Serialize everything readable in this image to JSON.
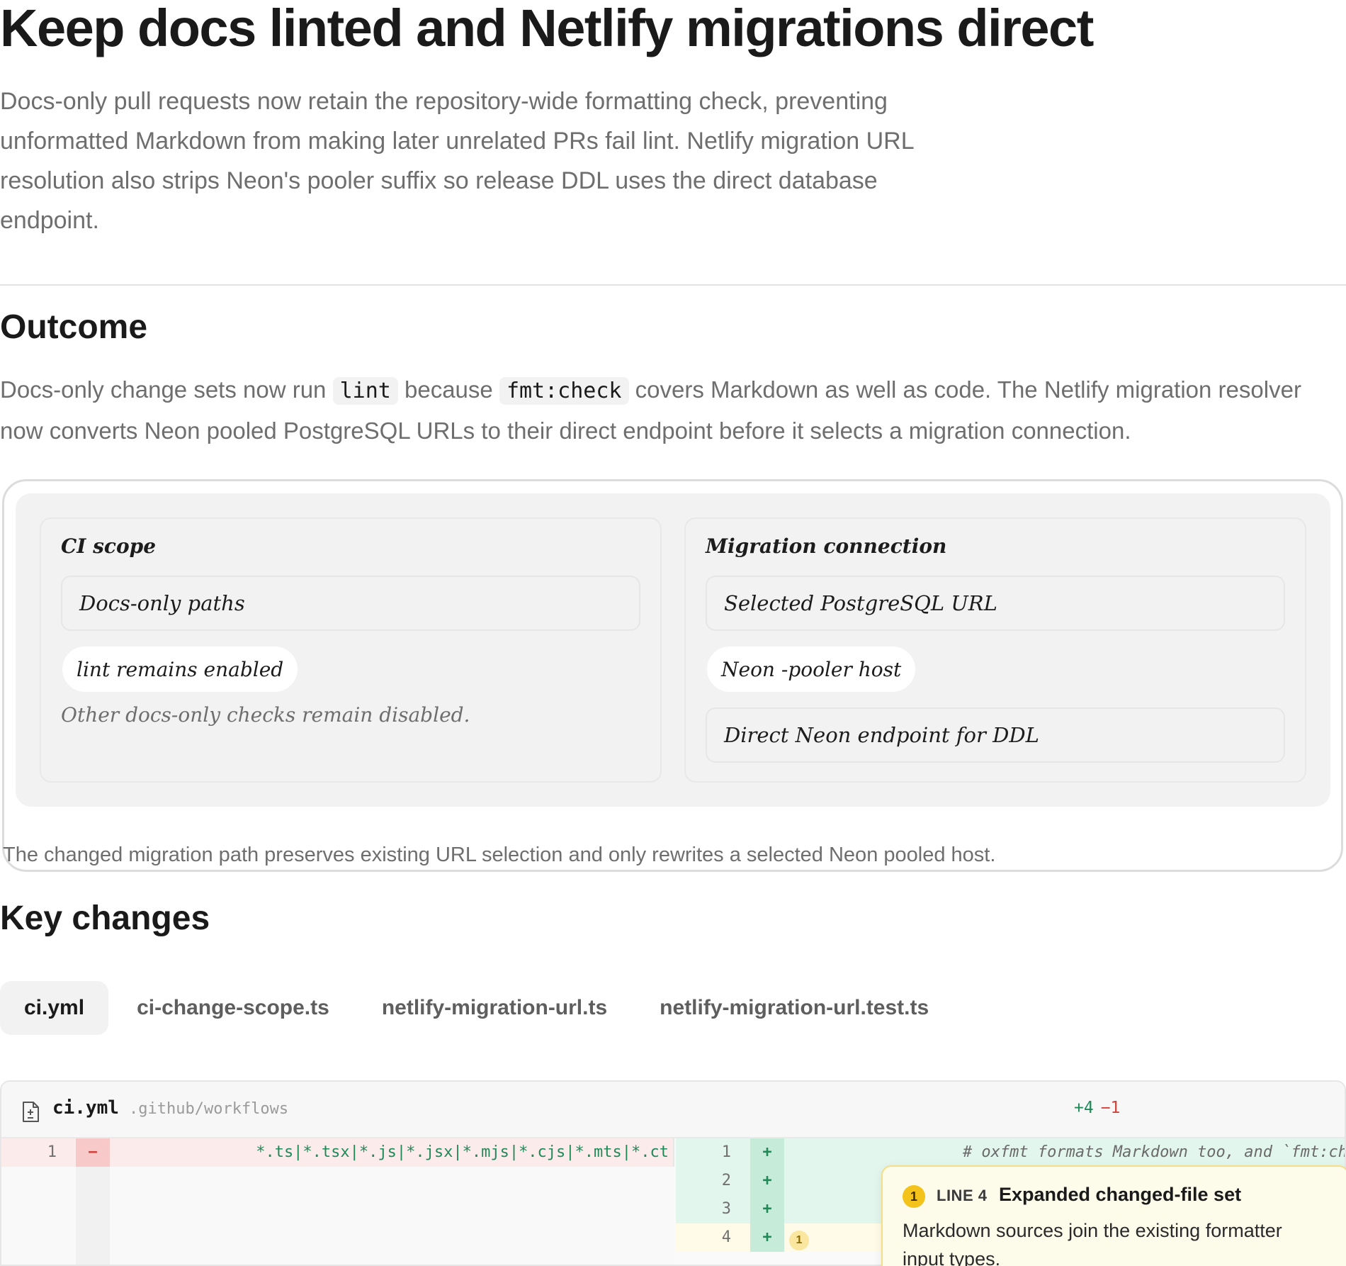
{
  "page": {
    "title": "Keep docs linted and Netlify migrations direct",
    "intro": "Docs-only pull requests now retain the repository-wide formatting check, preventing unformatted Markdown from making later unrelated PRs fail lint. Netlify migration URL resolution also strips Neon's pooler suffix so release DDL uses the direct database endpoint."
  },
  "outcome": {
    "heading": "Outcome",
    "text_1": "Docs-only change sets now run ",
    "code_1": "lint",
    "text_2": " because ",
    "code_2": "fmt:check",
    "text_3": " covers Markdown as well as code. The Netlify migration resolver now converts Neon pooled PostgreSQL URLs to their direct endpoint before it selects a migration connection."
  },
  "diagram": {
    "left_panel": {
      "title": "CI scope",
      "box": "Docs-only paths",
      "pill": "lint remains enabled",
      "note": "Other docs-only checks remain disabled."
    },
    "right_panel": {
      "title": "Migration connection",
      "box_top": "Selected PostgreSQL URL",
      "pill": "Neon -pooler host",
      "box_bottom": "Direct Neon endpoint for DDL"
    },
    "caption": "The changed migration path preserves existing URL selection and only rewrites a selected Neon pooled host."
  },
  "key_changes": {
    "heading": "Key changes",
    "tabs": [
      {
        "label": "ci.yml",
        "active": true
      },
      {
        "label": "ci-change-scope.ts",
        "active": false
      },
      {
        "label": "netlify-migration-url.ts",
        "active": false
      },
      {
        "label": "netlify-migration-url.test.ts",
        "active": false
      }
    ]
  },
  "diff": {
    "file_icon": "file-diff-icon",
    "filename": "ci.yml",
    "path": ".github/workflows",
    "additions": "+4",
    "deletions": "−1",
    "left": [
      {
        "ln": "1",
        "sign": "−",
        "code": "*.ts|*.tsx|*.js|*.jsx|*.mjs|*.cjs|*.mts|*.ct"
      }
    ],
    "right": [
      {
        "ln": "1",
        "sign": "+",
        "code": "# oxfmt formats Markdown too, and `fmt:ch"
      },
      {
        "ln": "2",
        "sign": "+",
        "code": ""
      },
      {
        "ln": "3",
        "sign": "+",
        "code": ""
      },
      {
        "ln": "4",
        "sign": "+",
        "code": "",
        "marker": "1"
      }
    ],
    "annotation": {
      "badge": "1",
      "line": "LINE 4",
      "title": "Expanded changed-file set",
      "body": "Markdown sources join the existing formatter input types."
    }
  },
  "colors": {
    "added_bg": "#e3f6ee",
    "removed_bg": "#fcebeb",
    "add_text": "#1f8a58",
    "del_text": "#d0423a",
    "annotation_badge": "#f3c21b"
  }
}
